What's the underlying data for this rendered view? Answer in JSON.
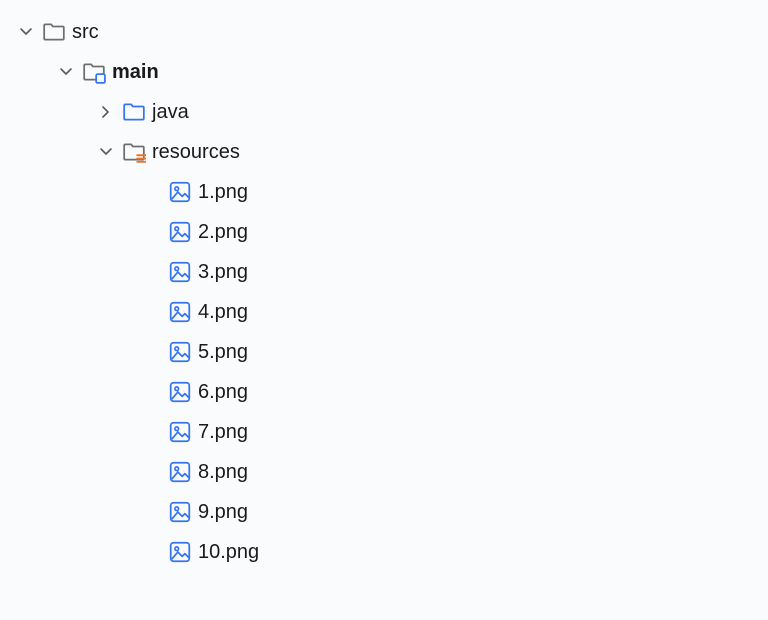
{
  "tree": {
    "src": {
      "label": "src"
    },
    "main": {
      "label": "main"
    },
    "java": {
      "label": "java"
    },
    "resources": {
      "label": "resources"
    },
    "files": [
      {
        "label": "1.png"
      },
      {
        "label": "2.png"
      },
      {
        "label": "3.png"
      },
      {
        "label": "4.png"
      },
      {
        "label": "5.png"
      },
      {
        "label": "6.png"
      },
      {
        "label": "7.png"
      },
      {
        "label": "8.png"
      },
      {
        "label": "9.png"
      },
      {
        "label": "10.png"
      }
    ]
  }
}
